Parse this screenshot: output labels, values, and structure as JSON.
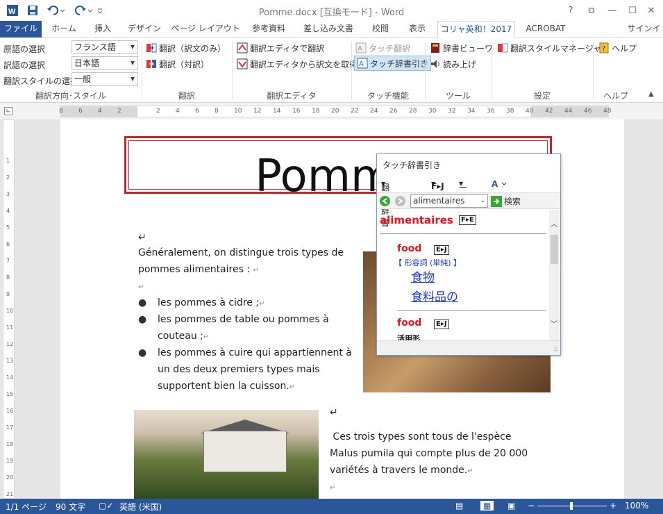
{
  "window": {
    "title": "Pomme.docx [互換モード] - Word",
    "help": "?",
    "ribbon_display": "⧉",
    "minimize": "—",
    "maximize": "☐",
    "close": "✕"
  },
  "tabs": [
    {
      "label": "ファイル"
    },
    {
      "label": "ホーム"
    },
    {
      "label": "挿入"
    },
    {
      "label": "デザイン"
    },
    {
      "label": "ページ レイアウト"
    },
    {
      "label": "参考資料"
    },
    {
      "label": "差し込み文書"
    },
    {
      "label": "校閲"
    },
    {
      "label": "表示"
    },
    {
      "label": "コリャ英和！2017"
    },
    {
      "label": "ACROBAT"
    }
  ],
  "signin": "サインイン",
  "ribbon": {
    "source_lang_label": "原語の選択",
    "source_lang_value": "フランス語",
    "target_lang_label": "訳語の選択",
    "target_lang_value": "日本語",
    "style_label": "翻訳スタイルの選択",
    "style_value": "一般",
    "group1": "翻訳方向･スタイル",
    "translate_only": "翻訳（訳文のみ）",
    "translate_pair": "翻訳（対訳）",
    "group2": "翻訳",
    "editor_translate": "翻訳エディタで翻訳",
    "editor_get": "翻訳エディタから訳文を取得",
    "group3": "翻訳エディタ",
    "touch_translate": "タッチ翻訳",
    "touch_dict": "タッチ辞書引き",
    "group4": "タッチ機能",
    "dict_viewer": "辞書ビューワ",
    "read_aloud": "読み上げ",
    "group5": "ツール",
    "style_manager": "翻訳スタイルマネージャ",
    "group6": "設定",
    "help": "ヘルプ",
    "group7": "ヘルプ"
  },
  "ruler": {
    "ticks": [
      "8",
      "6",
      "4",
      "2",
      "",
      "2",
      "4",
      "6",
      "8",
      "10",
      "12",
      "14",
      "16",
      "18",
      "20",
      "22",
      "24",
      "26",
      "28",
      "30",
      "32",
      "34",
      "36",
      "38",
      "40",
      "42",
      "44",
      "46",
      "48"
    ],
    "vticks": [
      "",
      "1",
      "2",
      "3",
      "4",
      "5",
      "6",
      "7",
      "8",
      "9",
      "10",
      "11",
      "12",
      "13",
      "14",
      "15",
      "16",
      "17",
      "18",
      "19",
      "20",
      "21",
      "22"
    ]
  },
  "document": {
    "title": "Pomme",
    "p1_line1": "Généralement, on distingue trois types de",
    "p1_line2": "pommes alimentaires :",
    "bullet1": "les pommes à cidre ;",
    "bullet2_line1": "les pommes de table ou pommes à",
    "bullet2_line2": "couteau ;",
    "bullet3_line1": "les pommes à cuire qui appartiennent à",
    "bullet3_line2": "un des deux premiers types mais",
    "bullet3_line3": "supportent bien la cuisson.",
    "p2_line1": "Ces trois types sont tous de l'espèce",
    "p2_line2": "Malus pumila qui compte plus de 20 000",
    "p2_line3": "variétés à travers le monde.",
    "mark": "↵"
  },
  "popup": {
    "title": "タッチ辞書引き",
    "tool_dict": "翻訳辞書",
    "tool_fj": "F▸J",
    "tool_general": "一般",
    "search_value": "alimentaires",
    "search_button": "検索",
    "headword": "alimentaires",
    "headword_tag": "F▸E",
    "entry1_word": "food",
    "entry1_tag": "E▸J",
    "entry1_pos": "【 形容詞 (単純) 】",
    "entry1_m1": "食物",
    "entry1_m2": "食料品の",
    "entry2_word": "food",
    "entry2_tag": "E▸J",
    "entry2_pos": "活用形"
  },
  "status": {
    "page": "1/1 ページ",
    "words": "90 文字",
    "lang": "英語 (米国)",
    "zoom": "100%"
  },
  "colors": {
    "accent": "#2b579a",
    "title_border": "#c0272d",
    "headword": "#e0161f",
    "link": "#1a39c7"
  }
}
